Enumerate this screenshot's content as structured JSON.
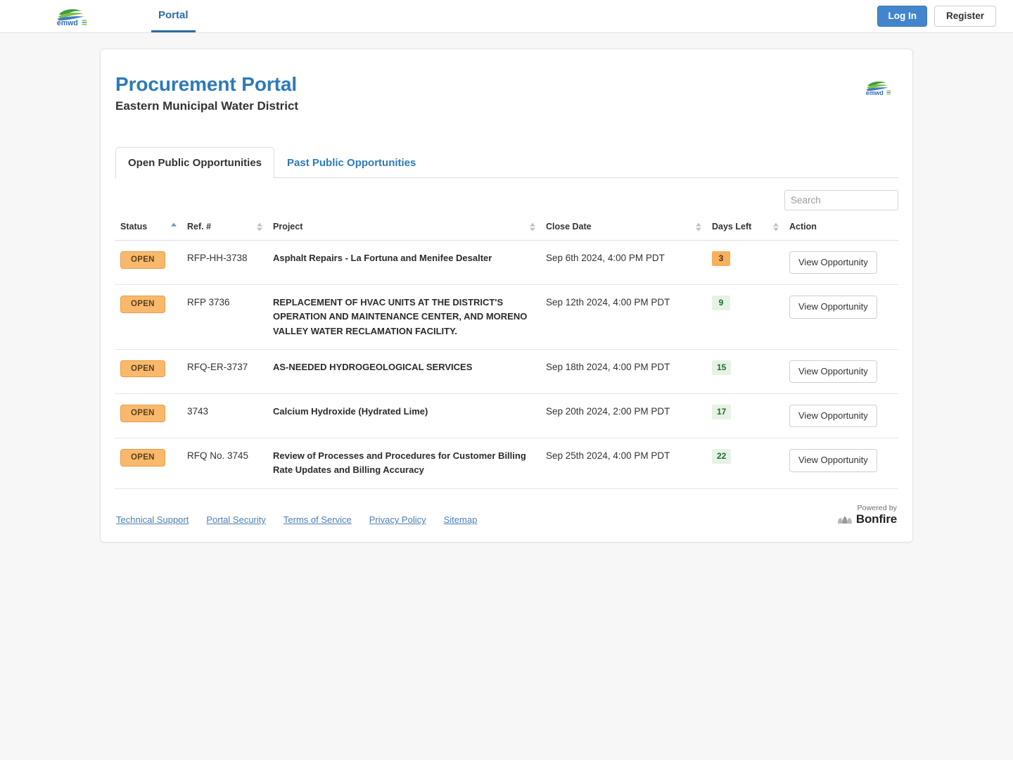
{
  "topnav": {
    "logo_alt": "emwd",
    "tabs": [
      {
        "label": "Portal",
        "active": true
      }
    ],
    "login_label": "Log In",
    "register_label": "Register"
  },
  "header": {
    "title": "Procurement Portal",
    "subtitle": "Eastern Municipal Water District",
    "logo_alt": "emwd"
  },
  "tabs": [
    {
      "label": "Open Public Opportunities",
      "active": true
    },
    {
      "label": "Past Public Opportunities",
      "active": false
    }
  ],
  "search": {
    "placeholder": "Search",
    "value": ""
  },
  "table": {
    "columns": [
      {
        "label": "Status",
        "sort": "asc"
      },
      {
        "label": "Ref. #",
        "sort": "none"
      },
      {
        "label": "Project",
        "sort": "none"
      },
      {
        "label": "Close Date",
        "sort": "none"
      },
      {
        "label": "Days Left",
        "sort": "none"
      },
      {
        "label": "Action",
        "sort": null
      }
    ],
    "rows": [
      {
        "status": "OPEN",
        "ref": "RFP-HH-3738",
        "project": "Asphalt Repairs - La Fortuna and Menifee Desalter",
        "close_date": "Sep 6th 2024, 4:00 PM PDT",
        "days_left": "3",
        "days_state": "urgent",
        "action": "View Opportunity"
      },
      {
        "status": "OPEN",
        "ref": "RFP 3736",
        "project": "REPLACEMENT OF HVAC UNITS AT THE DISTRICT'S OPERATION AND MAINTENANCE CENTER, AND MORENO VALLEY WATER RECLAMATION FACILITY.",
        "close_date": "Sep 12th 2024, 4:00 PM PDT",
        "days_left": "9",
        "days_state": "ok",
        "action": "View Opportunity"
      },
      {
        "status": "OPEN",
        "ref": "RFQ-ER-3737",
        "project": "AS-NEEDED HYDROGEOLOGICAL SERVICES",
        "close_date": "Sep 18th 2024, 4:00 PM PDT",
        "days_left": "15",
        "days_state": "ok",
        "action": "View Opportunity"
      },
      {
        "status": "OPEN",
        "ref": "3743",
        "project": "Calcium Hydroxide (Hydrated Lime)",
        "close_date": "Sep 20th 2024, 2:00 PM PDT",
        "days_left": "17",
        "days_state": "ok",
        "action": "View Opportunity"
      },
      {
        "status": "OPEN",
        "ref": "RFQ No. 3745",
        "project": "Review of Processes and Procedures for Customer Billing Rate Updates and Billing Accuracy",
        "close_date": "Sep 25th 2024, 4:00 PM PDT",
        "days_left": "22",
        "days_state": "ok",
        "action": "View Opportunity"
      }
    ]
  },
  "footer": {
    "links": [
      "Technical Support",
      "Portal Security",
      "Terms of Service",
      "Privacy Policy",
      "Sitemap"
    ],
    "powered_by_label": "Powered by",
    "powered_by_brand": "Bonfire"
  },
  "colors": {
    "accent_blue": "#2d7ab8",
    "badge_open_bg": "#f9b96d",
    "days_urgent_bg": "#f7b05b",
    "days_ok_bg": "#e6f2e4",
    "login_blue": "#4285cc"
  }
}
